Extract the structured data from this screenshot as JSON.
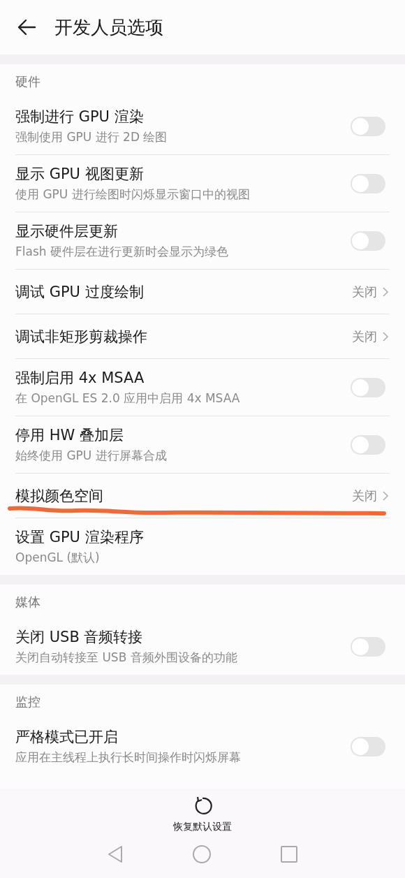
{
  "header": {
    "title": "开发人员选项"
  },
  "sections": [
    {
      "title": "硬件",
      "items": [
        {
          "kind": "switch",
          "title": "强制进行 GPU 渲染",
          "subtitle": "强制使用 GPU 进行 2D 绘图",
          "on": false
        },
        {
          "kind": "switch",
          "title": "显示 GPU 视图更新",
          "subtitle": "使用 GPU 进行绘图时闪烁显示窗口中的视图",
          "on": false
        },
        {
          "kind": "switch",
          "title": "显示硬件层更新",
          "subtitle": "Flash 硬件层在进行更新时会显示为绿色",
          "on": false
        },
        {
          "kind": "link",
          "title": "调试 GPU 过度绘制",
          "value": "关闭",
          "underlined": false
        },
        {
          "kind": "link",
          "title": "调试非矩形剪裁操作",
          "value": "关闭",
          "underlined": false
        },
        {
          "kind": "switch",
          "title": "强制启用 4x MSAA",
          "subtitle": "在 OpenGL ES 2.0 应用中启用 4x MSAA",
          "on": false
        },
        {
          "kind": "switch",
          "title": "停用 HW 叠加层",
          "subtitle": "始终使用 GPU 进行屏幕合成",
          "on": false
        },
        {
          "kind": "link",
          "title": "模拟颜色空间",
          "value": "关闭",
          "underlined": true
        },
        {
          "kind": "info",
          "title": "设置 GPU 渲染程序",
          "subtitle": "OpenGL (默认)"
        }
      ]
    },
    {
      "title": "媒体",
      "items": [
        {
          "kind": "switch",
          "title": "关闭 USB 音频转接",
          "subtitle": "关闭自动转接至 USB 音频外围设备的功能",
          "on": false
        }
      ]
    },
    {
      "title": "监控",
      "items": [
        {
          "kind": "switch",
          "title": "严格模式已开启",
          "subtitle": "应用在主线程上执行长时间操作时闪烁屏幕",
          "on": false
        }
      ]
    }
  ],
  "footer": {
    "label": "恢复默认设置"
  }
}
